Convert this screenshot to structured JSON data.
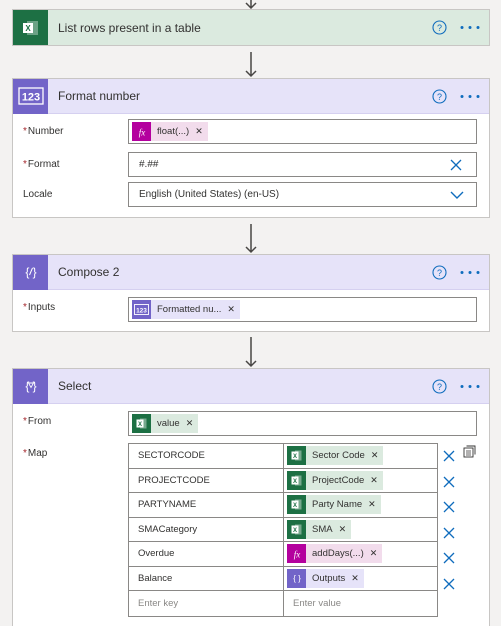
{
  "actions": {
    "list_rows": {
      "title": "List rows present in a table",
      "icon": "excel-icon"
    },
    "format_number": {
      "title": "Format number",
      "icon": "number-format-icon",
      "number_label": "Number",
      "number_token": "float(...)",
      "format_label": "Format",
      "format_value": "#.##",
      "locale_label": "Locale",
      "locale_value": "English (United States) (en-US)"
    },
    "compose": {
      "title": "Compose 2",
      "icon": "compose-icon",
      "inputs_label": "Inputs",
      "inputs_token": "Formatted nu..."
    },
    "select": {
      "title": "Select",
      "icon": "select-icon",
      "from_label": "From",
      "from_token": "value",
      "map_label": "Map",
      "map_rows": [
        {
          "key": "SECTORCODE",
          "value": "Sector Code",
          "type": "excel"
        },
        {
          "key": "PROJECTCODE",
          "value": "ProjectCode",
          "type": "excel"
        },
        {
          "key": "PARTYNAME",
          "value": "Party Name",
          "type": "excel"
        },
        {
          "key": "SMACategory",
          "value": "SMA",
          "type": "excel"
        },
        {
          "key": "Overdue",
          "value": "addDays(...)",
          "type": "expression"
        },
        {
          "key": "Balance",
          "value": "Outputs",
          "type": "variable"
        }
      ],
      "key_placeholder": "Enter key",
      "value_placeholder": "Enter value"
    }
  },
  "colors": {
    "excel_green": "#1d7044",
    "purple": "#7264c8",
    "expression_magenta": "#b4009e",
    "link_blue": "#0f6cbd"
  }
}
